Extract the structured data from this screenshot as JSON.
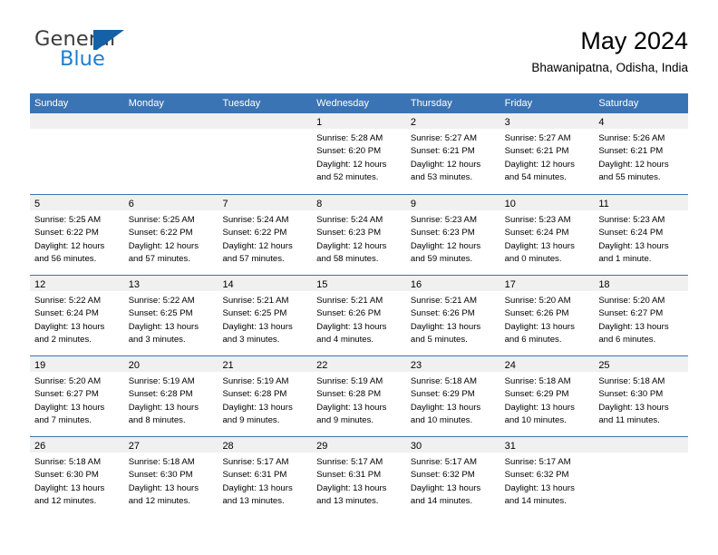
{
  "brand": {
    "name_part1": "General",
    "name_part2": "Blue",
    "icon": "flag-triangle-icon",
    "color_dark": "#3c3c3b",
    "color_blue": "#1b7fd4"
  },
  "header": {
    "title": "May 2024",
    "location": "Bhawanipatna, Odisha, India"
  },
  "theme": {
    "header_blue": "#3b74b4",
    "day_band_gray": "#f0f0f0",
    "text_black": "#000000"
  },
  "weekdays": [
    "Sunday",
    "Monday",
    "Tuesday",
    "Wednesday",
    "Thursday",
    "Friday",
    "Saturday"
  ],
  "weeks": [
    [
      {
        "day": "",
        "sunrise": "",
        "sunset": "",
        "daylight_line1": "",
        "daylight_line2": ""
      },
      {
        "day": "",
        "sunrise": "",
        "sunset": "",
        "daylight_line1": "",
        "daylight_line2": ""
      },
      {
        "day": "",
        "sunrise": "",
        "sunset": "",
        "daylight_line1": "",
        "daylight_line2": ""
      },
      {
        "day": "1",
        "sunrise": "Sunrise: 5:28 AM",
        "sunset": "Sunset: 6:20 PM",
        "daylight_line1": "Daylight: 12 hours",
        "daylight_line2": "and 52 minutes."
      },
      {
        "day": "2",
        "sunrise": "Sunrise: 5:27 AM",
        "sunset": "Sunset: 6:21 PM",
        "daylight_line1": "Daylight: 12 hours",
        "daylight_line2": "and 53 minutes."
      },
      {
        "day": "3",
        "sunrise": "Sunrise: 5:27 AM",
        "sunset": "Sunset: 6:21 PM",
        "daylight_line1": "Daylight: 12 hours",
        "daylight_line2": "and 54 minutes."
      },
      {
        "day": "4",
        "sunrise": "Sunrise: 5:26 AM",
        "sunset": "Sunset: 6:21 PM",
        "daylight_line1": "Daylight: 12 hours",
        "daylight_line2": "and 55 minutes."
      }
    ],
    [
      {
        "day": "5",
        "sunrise": "Sunrise: 5:25 AM",
        "sunset": "Sunset: 6:22 PM",
        "daylight_line1": "Daylight: 12 hours",
        "daylight_line2": "and 56 minutes."
      },
      {
        "day": "6",
        "sunrise": "Sunrise: 5:25 AM",
        "sunset": "Sunset: 6:22 PM",
        "daylight_line1": "Daylight: 12 hours",
        "daylight_line2": "and 57 minutes."
      },
      {
        "day": "7",
        "sunrise": "Sunrise: 5:24 AM",
        "sunset": "Sunset: 6:22 PM",
        "daylight_line1": "Daylight: 12 hours",
        "daylight_line2": "and 57 minutes."
      },
      {
        "day": "8",
        "sunrise": "Sunrise: 5:24 AM",
        "sunset": "Sunset: 6:23 PM",
        "daylight_line1": "Daylight: 12 hours",
        "daylight_line2": "and 58 minutes."
      },
      {
        "day": "9",
        "sunrise": "Sunrise: 5:23 AM",
        "sunset": "Sunset: 6:23 PM",
        "daylight_line1": "Daylight: 12 hours",
        "daylight_line2": "and 59 minutes."
      },
      {
        "day": "10",
        "sunrise": "Sunrise: 5:23 AM",
        "sunset": "Sunset: 6:24 PM",
        "daylight_line1": "Daylight: 13 hours",
        "daylight_line2": "and 0 minutes."
      },
      {
        "day": "11",
        "sunrise": "Sunrise: 5:23 AM",
        "sunset": "Sunset: 6:24 PM",
        "daylight_line1": "Daylight: 13 hours",
        "daylight_line2": "and 1 minute."
      }
    ],
    [
      {
        "day": "12",
        "sunrise": "Sunrise: 5:22 AM",
        "sunset": "Sunset: 6:24 PM",
        "daylight_line1": "Daylight: 13 hours",
        "daylight_line2": "and 2 minutes."
      },
      {
        "day": "13",
        "sunrise": "Sunrise: 5:22 AM",
        "sunset": "Sunset: 6:25 PM",
        "daylight_line1": "Daylight: 13 hours",
        "daylight_line2": "and 3 minutes."
      },
      {
        "day": "14",
        "sunrise": "Sunrise: 5:21 AM",
        "sunset": "Sunset: 6:25 PM",
        "daylight_line1": "Daylight: 13 hours",
        "daylight_line2": "and 3 minutes."
      },
      {
        "day": "15",
        "sunrise": "Sunrise: 5:21 AM",
        "sunset": "Sunset: 6:26 PM",
        "daylight_line1": "Daylight: 13 hours",
        "daylight_line2": "and 4 minutes."
      },
      {
        "day": "16",
        "sunrise": "Sunrise: 5:21 AM",
        "sunset": "Sunset: 6:26 PM",
        "daylight_line1": "Daylight: 13 hours",
        "daylight_line2": "and 5 minutes."
      },
      {
        "day": "17",
        "sunrise": "Sunrise: 5:20 AM",
        "sunset": "Sunset: 6:26 PM",
        "daylight_line1": "Daylight: 13 hours",
        "daylight_line2": "and 6 minutes."
      },
      {
        "day": "18",
        "sunrise": "Sunrise: 5:20 AM",
        "sunset": "Sunset: 6:27 PM",
        "daylight_line1": "Daylight: 13 hours",
        "daylight_line2": "and 6 minutes."
      }
    ],
    [
      {
        "day": "19",
        "sunrise": "Sunrise: 5:20 AM",
        "sunset": "Sunset: 6:27 PM",
        "daylight_line1": "Daylight: 13 hours",
        "daylight_line2": "and 7 minutes."
      },
      {
        "day": "20",
        "sunrise": "Sunrise: 5:19 AM",
        "sunset": "Sunset: 6:28 PM",
        "daylight_line1": "Daylight: 13 hours",
        "daylight_line2": "and 8 minutes."
      },
      {
        "day": "21",
        "sunrise": "Sunrise: 5:19 AM",
        "sunset": "Sunset: 6:28 PM",
        "daylight_line1": "Daylight: 13 hours",
        "daylight_line2": "and 9 minutes."
      },
      {
        "day": "22",
        "sunrise": "Sunrise: 5:19 AM",
        "sunset": "Sunset: 6:28 PM",
        "daylight_line1": "Daylight: 13 hours",
        "daylight_line2": "and 9 minutes."
      },
      {
        "day": "23",
        "sunrise": "Sunrise: 5:18 AM",
        "sunset": "Sunset: 6:29 PM",
        "daylight_line1": "Daylight: 13 hours",
        "daylight_line2": "and 10 minutes."
      },
      {
        "day": "24",
        "sunrise": "Sunrise: 5:18 AM",
        "sunset": "Sunset: 6:29 PM",
        "daylight_line1": "Daylight: 13 hours",
        "daylight_line2": "and 10 minutes."
      },
      {
        "day": "25",
        "sunrise": "Sunrise: 5:18 AM",
        "sunset": "Sunset: 6:30 PM",
        "daylight_line1": "Daylight: 13 hours",
        "daylight_line2": "and 11 minutes."
      }
    ],
    [
      {
        "day": "26",
        "sunrise": "Sunrise: 5:18 AM",
        "sunset": "Sunset: 6:30 PM",
        "daylight_line1": "Daylight: 13 hours",
        "daylight_line2": "and 12 minutes."
      },
      {
        "day": "27",
        "sunrise": "Sunrise: 5:18 AM",
        "sunset": "Sunset: 6:30 PM",
        "daylight_line1": "Daylight: 13 hours",
        "daylight_line2": "and 12 minutes."
      },
      {
        "day": "28",
        "sunrise": "Sunrise: 5:17 AM",
        "sunset": "Sunset: 6:31 PM",
        "daylight_line1": "Daylight: 13 hours",
        "daylight_line2": "and 13 minutes."
      },
      {
        "day": "29",
        "sunrise": "Sunrise: 5:17 AM",
        "sunset": "Sunset: 6:31 PM",
        "daylight_line1": "Daylight: 13 hours",
        "daylight_line2": "and 13 minutes."
      },
      {
        "day": "30",
        "sunrise": "Sunrise: 5:17 AM",
        "sunset": "Sunset: 6:32 PM",
        "daylight_line1": "Daylight: 13 hours",
        "daylight_line2": "and 14 minutes."
      },
      {
        "day": "31",
        "sunrise": "Sunrise: 5:17 AM",
        "sunset": "Sunset: 6:32 PM",
        "daylight_line1": "Daylight: 13 hours",
        "daylight_line2": "and 14 minutes."
      },
      {
        "day": "",
        "sunrise": "",
        "sunset": "",
        "daylight_line1": "",
        "daylight_line2": ""
      }
    ]
  ]
}
